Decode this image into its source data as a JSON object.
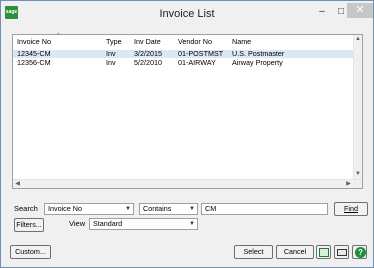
{
  "window": {
    "logo_text": "sage",
    "title": "Invoice List",
    "minimize_glyph": "–",
    "maximize_glyph": "□",
    "close_glyph": "✕"
  },
  "list": {
    "columns": [
      "Invoice No",
      "Type",
      "Inv Date",
      "Vendor No",
      "Name"
    ],
    "sort_indicator": "^",
    "rows": [
      [
        "12345-CM",
        "Inv",
        "3/2/2015",
        "01-POSTMST",
        "U.S. Postmaster"
      ],
      [
        "12356-CM",
        "Inv",
        "5/2/2010",
        "01-AIRWAY",
        "Airway Property"
      ]
    ]
  },
  "search": {
    "label": "Search",
    "field": "Invoice No",
    "operator": "Contains",
    "value": "CM",
    "find_label": "Find",
    "filters_label": "Filters...",
    "view_label": "View",
    "view_value": "Standard"
  },
  "footer": {
    "custom_label": "Custom...",
    "select_label": "Select",
    "cancel_label": "Cancel",
    "help_glyph": "?"
  },
  "colors": {
    "selected_row": "#dbe7f5",
    "logo_green": "#2f8f3a",
    "border": "#a0a0a0"
  },
  "icons": [
    "sage-logo-icon",
    "minimize-icon",
    "maximize-icon",
    "close-icon",
    "sort-ascending-icon",
    "export-excel-icon",
    "print-icon",
    "help-icon"
  ]
}
